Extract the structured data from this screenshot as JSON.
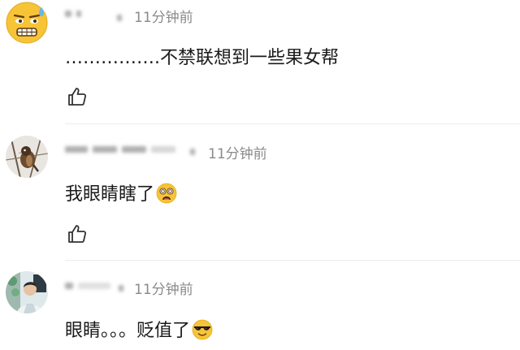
{
  "comments": [
    {
      "timestamp": "11分钟前",
      "text": "…………….不禁联想到一些果女帮",
      "avatar_icon": "grimacing-face-emoji-icon",
      "like_icon": "thumbs-up-outline-icon"
    },
    {
      "timestamp": "11分钟前",
      "text": "我眼睛瞎了",
      "inline_emoji": "dizzy-face-emoji-icon",
      "avatar_icon": "bird-photo-avatar",
      "like_icon": "thumbs-up-outline-icon"
    },
    {
      "timestamp": "11分钟前",
      "text": "眼睛。。。贬值了",
      "inline_emoji": "sunglasses-face-emoji-icon",
      "avatar_icon": "person-photo-avatar"
    }
  ],
  "colors": {
    "timestamp": "#8a8a8a",
    "text": "#1a1a1a",
    "divider": "#ececec",
    "like_icon": "#333333"
  }
}
